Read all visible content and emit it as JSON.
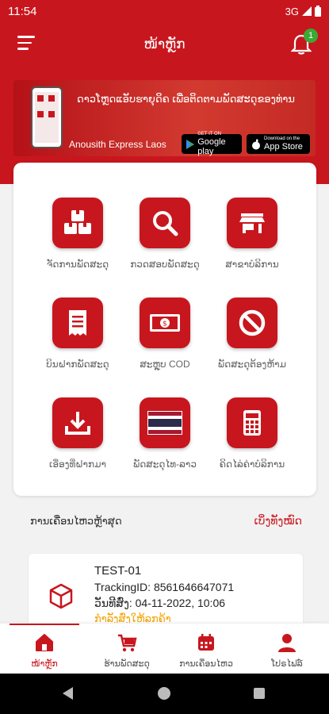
{
  "status_bar": {
    "time": "11:54",
    "network": "3G"
  },
  "app_bar": {
    "title": "ໜ້າຫຼັກ",
    "notification_count": "1"
  },
  "banner": {
    "tagline": "ດາວໂຫຼດແອັບຮາຍຸດິຄ ເພື່ອຕິດຕາມພັດສະດຸຂອງທ່ານ",
    "brand": "Anousith Express Laos",
    "google_play": {
      "small": "GET IT ON",
      "big": "Google play"
    },
    "app_store": {
      "small": "Download on the",
      "big": "App Store"
    }
  },
  "grid": [
    {
      "label": "ຈັດການພັດສະດຸ",
      "icon": "boxes-icon"
    },
    {
      "label": "ກວດສອບພັດສະດຸ",
      "icon": "search-icon"
    },
    {
      "label": "ສາຂາບໍລິການ",
      "icon": "store-icon"
    },
    {
      "label": "ບິນຝາກພັດສະດຸ",
      "icon": "receipt-icon"
    },
    {
      "label": "ສະຫຼຸບ COD",
      "icon": "cash-icon"
    },
    {
      "label": "ພັດສະດຸຕ້ອງຫ້າມ",
      "icon": "prohibited-icon"
    },
    {
      "label": "ເອື່ອງທີ່ຝາກມາ",
      "icon": "download-icon"
    },
    {
      "label": "ພັດສະດຸໄທ-ລາວ",
      "icon": "thai-flag-icon"
    },
    {
      "label": "ຄິດໄລ່ຄ່າບໍລິການ",
      "icon": "calculator-icon"
    }
  ],
  "recent": {
    "title": "ການເຄື່ອນໄຫວຫຼ້າສຸດ",
    "view_all": "ເບິ່ງທັງໝົດ",
    "item": {
      "name": "TEST-01",
      "tracking": "TrackingID: 8561646647071",
      "date": "ວັນທີສົ່ງ: 04-11-2022, 10:06",
      "status": "ກຳລັງສົ່ງໃຫ້ລູກຄ້າ"
    }
  },
  "bottom_nav": [
    {
      "label": "ໜ້າຫຼັກ",
      "icon": "home-icon",
      "active": true
    },
    {
      "label": "ຮ້ານພັດສະດຸ",
      "icon": "cart-icon",
      "active": false
    },
    {
      "label": "ການເຄື່ອນໄຫວ",
      "icon": "calendar-icon",
      "active": false
    },
    {
      "label": "ໂປຣໄຟລ໌",
      "icon": "profile-icon",
      "active": false
    }
  ],
  "colors": {
    "brand": "#c8161e",
    "badge": "#3aaa35",
    "status": "#f2a300"
  }
}
